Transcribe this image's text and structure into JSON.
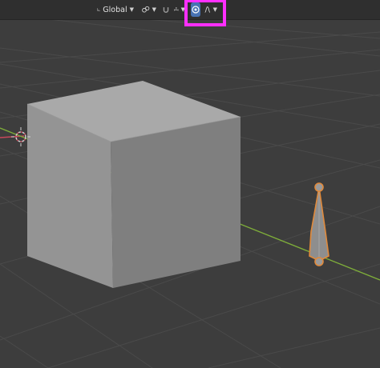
{
  "header": {
    "orientation": {
      "label": "Global",
      "icon": "transform-orientation-icon"
    },
    "pivot": {
      "icon": "pivot-point-icon"
    },
    "snap": {
      "toggle_icon": "snap-magnet-icon",
      "target_icon": "snap-increment-icon"
    },
    "proportional_editing": {
      "enabled": true,
      "icon": "proportional-editing-icon"
    },
    "falloff": {
      "icon": "smooth-falloff-icon"
    },
    "highlight_color": "#ff2fff",
    "accent_color": "#4772b3"
  },
  "scene": {
    "cube": {
      "color": "#8e8e8e"
    },
    "bone": {
      "selected": true,
      "outline_color": "#e08a3c"
    },
    "cursor": {
      "icon": "3d-cursor-icon"
    },
    "axes": {
      "x_color": "#c8485a",
      "y_color": "#7fae3a"
    }
  }
}
